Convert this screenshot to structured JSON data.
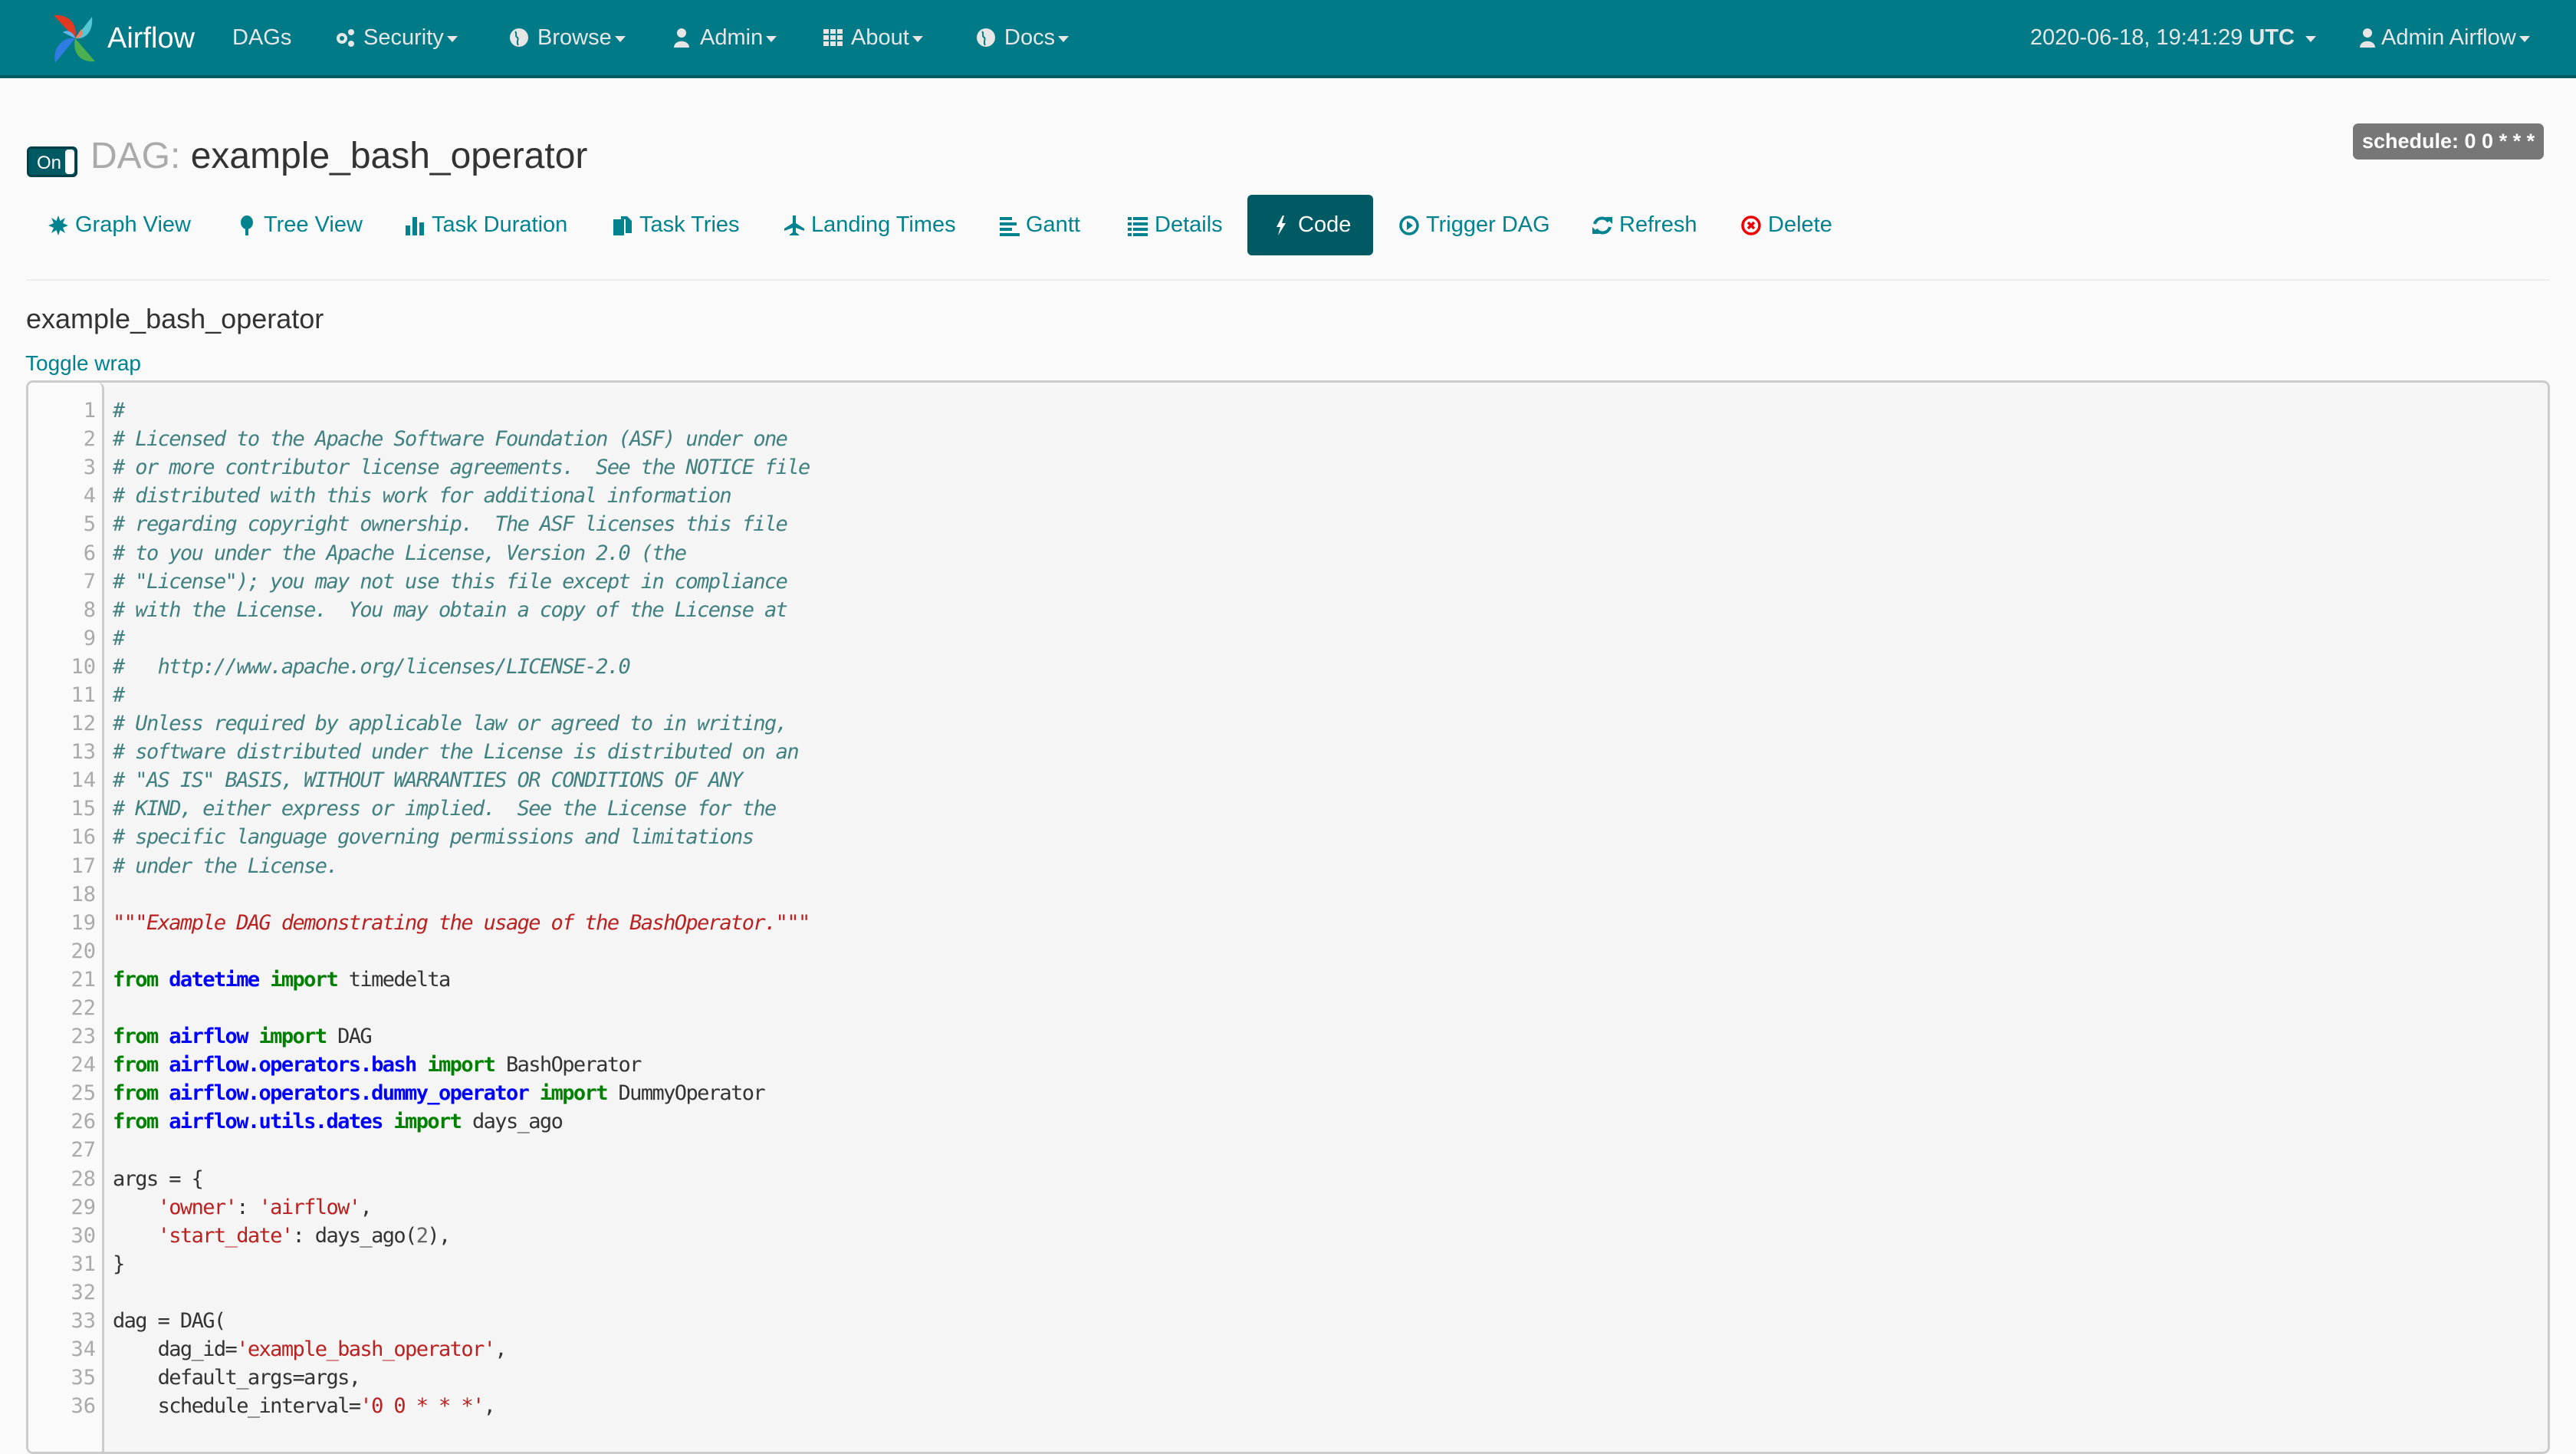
{
  "navbar": {
    "brand": "Airflow",
    "items": [
      {
        "label": "DAGs",
        "icon": "",
        "dropdown": false
      },
      {
        "label": "Security",
        "icon": "gears-icon",
        "dropdown": true
      },
      {
        "label": "Browse",
        "icon": "globe-icon",
        "dropdown": true
      },
      {
        "label": "Admin",
        "icon": "user-icon",
        "dropdown": true
      },
      {
        "label": "About",
        "icon": "grid-icon",
        "dropdown": true
      },
      {
        "label": "Docs",
        "icon": "globe-icon",
        "dropdown": true
      }
    ],
    "time": "2020-06-18, 19:41:29",
    "timezone": "UTC",
    "user": "Admin Airflow"
  },
  "dag": {
    "toggle_label": "On",
    "title_prefix": "DAG:",
    "title_name": "example_bash_operator",
    "schedule": "schedule: 0 0 * * *"
  },
  "tabs": [
    {
      "label": "Graph View",
      "icon": "asterisk-icon"
    },
    {
      "label": "Tree View",
      "icon": "tree-icon"
    },
    {
      "label": "Task Duration",
      "icon": "bar-chart-icon"
    },
    {
      "label": "Task Tries",
      "icon": "files-icon"
    },
    {
      "label": "Landing Times",
      "icon": "plane-icon"
    },
    {
      "label": "Gantt",
      "icon": "align-left-icon"
    },
    {
      "label": "Details",
      "icon": "list-icon"
    },
    {
      "label": "Code",
      "icon": "flash-icon",
      "active": true
    },
    {
      "label": "Trigger DAG",
      "icon": "play-circle-icon"
    },
    {
      "label": "Refresh",
      "icon": "refresh-icon"
    },
    {
      "label": "Delete",
      "icon": "remove-circle-icon"
    }
  ],
  "code": {
    "title": "example_bash_operator",
    "toggle_wrap": "Toggle wrap",
    "lines": [
      [
        [
          "comment",
          "#"
        ]
      ],
      [
        [
          "comment",
          "# Licensed to the Apache Software Foundation (ASF) under one"
        ]
      ],
      [
        [
          "comment",
          "# or more contributor license agreements.  See the NOTICE file"
        ]
      ],
      [
        [
          "comment",
          "# distributed with this work for additional information"
        ]
      ],
      [
        [
          "comment",
          "# regarding copyright ownership.  The ASF licenses this file"
        ]
      ],
      [
        [
          "comment",
          "# to you under the Apache License, Version 2.0 (the"
        ]
      ],
      [
        [
          "comment",
          "# \"License\"); you may not use this file except in compliance"
        ]
      ],
      [
        [
          "comment",
          "# with the License.  You may obtain a copy of the License at"
        ]
      ],
      [
        [
          "comment",
          "#"
        ]
      ],
      [
        [
          "comment",
          "#   http://www.apache.org/licenses/LICENSE-2.0"
        ]
      ],
      [
        [
          "comment",
          "#"
        ]
      ],
      [
        [
          "comment",
          "# Unless required by applicable law or agreed to in writing,"
        ]
      ],
      [
        [
          "comment",
          "# software distributed under the License is distributed on an"
        ]
      ],
      [
        [
          "comment",
          "# \"AS IS\" BASIS, WITHOUT WARRANTIES OR CONDITIONS OF ANY"
        ]
      ],
      [
        [
          "comment",
          "# KIND, either express or implied.  See the License for the"
        ]
      ],
      [
        [
          "comment",
          "# specific language governing permissions and limitations"
        ]
      ],
      [
        [
          "comment",
          "# under the License."
        ]
      ],
      [],
      [
        [
          "doc",
          "\"\"\"Example DAG demonstrating the usage of the BashOperator.\"\"\""
        ]
      ],
      [],
      [
        [
          "kw",
          "from"
        ],
        [
          "plain",
          " "
        ],
        [
          "mod",
          "datetime"
        ],
        [
          "plain",
          " "
        ],
        [
          "kw",
          "import"
        ],
        [
          "plain",
          " timedelta"
        ]
      ],
      [],
      [
        [
          "kw",
          "from"
        ],
        [
          "plain",
          " "
        ],
        [
          "mod",
          "airflow"
        ],
        [
          "plain",
          " "
        ],
        [
          "kw",
          "import"
        ],
        [
          "plain",
          " DAG"
        ]
      ],
      [
        [
          "kw",
          "from"
        ],
        [
          "plain",
          " "
        ],
        [
          "mod",
          "airflow.operators.bash"
        ],
        [
          "plain",
          " "
        ],
        [
          "kw",
          "import"
        ],
        [
          "plain",
          " BashOperator"
        ]
      ],
      [
        [
          "kw",
          "from"
        ],
        [
          "plain",
          " "
        ],
        [
          "mod",
          "airflow.operators.dummy_operator"
        ],
        [
          "plain",
          " "
        ],
        [
          "kw",
          "import"
        ],
        [
          "plain",
          " DummyOperator"
        ]
      ],
      [
        [
          "kw",
          "from"
        ],
        [
          "plain",
          " "
        ],
        [
          "mod",
          "airflow.utils.dates"
        ],
        [
          "plain",
          " "
        ],
        [
          "kw",
          "import"
        ],
        [
          "plain",
          " days_ago"
        ]
      ],
      [],
      [
        [
          "plain",
          "args = {"
        ]
      ],
      [
        [
          "plain",
          "    "
        ],
        [
          "str",
          "'owner'"
        ],
        [
          "plain",
          ": "
        ],
        [
          "str",
          "'airflow'"
        ],
        [
          "plain",
          ","
        ]
      ],
      [
        [
          "plain",
          "    "
        ],
        [
          "str",
          "'start_date'"
        ],
        [
          "plain",
          ": days_ago("
        ],
        [
          "num",
          "2"
        ],
        [
          "plain",
          "),"
        ]
      ],
      [
        [
          "plain",
          "}"
        ]
      ],
      [],
      [
        [
          "plain",
          "dag = DAG("
        ]
      ],
      [
        [
          "plain",
          "    dag_id="
        ],
        [
          "str",
          "'example_bash_operator'"
        ],
        [
          "plain",
          ","
        ]
      ],
      [
        [
          "plain",
          "    default_args=args,"
        ]
      ],
      [
        [
          "plain",
          "    schedule_interval="
        ],
        [
          "str",
          "'0 0 * * *'"
        ],
        [
          "plain",
          ","
        ]
      ]
    ]
  },
  "colors": {
    "navbar": "#007a87",
    "accent": "#00828f",
    "active_tab": "#005a64",
    "danger": "#ee0000"
  }
}
